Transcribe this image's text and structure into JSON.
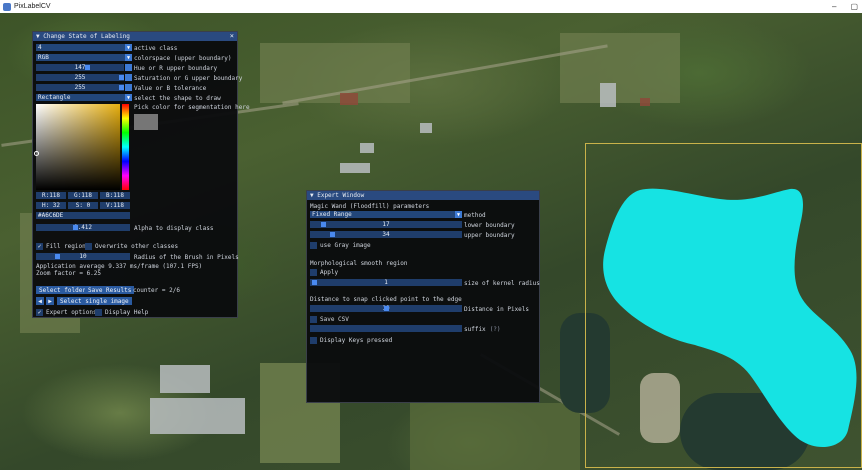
{
  "window": {
    "title": "PixLabelCV",
    "minimize": "–",
    "maximize": "▢"
  },
  "labeling": {
    "title": "▼ Change State of Labeling",
    "close": "×",
    "active_class_value": "4",
    "active_class_label": "active class",
    "colorspace_value": "RGB",
    "colorspace_label": "colorspace (upper boundary)",
    "hue_value": "147",
    "hue_label": "Hue or R upper boundary",
    "sat_value": "255",
    "sat_label": "Saturation or G upper boundary",
    "val_value": "255",
    "val_label": "Value or B tolerance",
    "shape_value": "Rectangle",
    "shape_label": "select the shape to draw",
    "pick_color_label": "Pick color for segmentation here",
    "rgb_r": "R:118",
    "rgb_g": "G:118",
    "rgb_b": "B:118",
    "hsv_h": "H: 32",
    "hsv_s": "S: 0",
    "hsv_v": "V:118",
    "hex": "#A6C6DE",
    "alpha_value": "0.412",
    "alpha_label": "Alpha to display class",
    "fill_region": "Fill region",
    "overwrite": "Overwrite other classes",
    "brush_value": "10",
    "brush_label": "Radius of the Brush in Pixels",
    "perf": "Application average 9.337 ms/frame (107.1 FPS)",
    "zoom": "Zoom factor = 6.25",
    "select_folder": "Select folder",
    "save_results": "Save Results",
    "counter": "counter = 2/6",
    "prev": "◀",
    "next": "▶",
    "select_image": "Select single image",
    "expert_options": "Expert options",
    "display_help": "Display Help",
    "hue_fraction": 0.58,
    "sat_fraction": 1.0,
    "val_fraction": 1.0,
    "alpha_fraction": 0.41,
    "brush_fraction": 0.2
  },
  "expert": {
    "title": "▼ Expert Window",
    "magic_wand_label": "Magic Wand (Floodfill) parameters",
    "method_value": "Fixed Range",
    "method_label": "method",
    "lower_value": "17",
    "lower_label": "lower boundary",
    "upper_value": "34",
    "upper_label": "upper boundary",
    "use_gray": "use Gray image",
    "morph_label": "Morphological smooth region",
    "apply": "Apply",
    "kernel_value": "1",
    "kernel_label": "size of kernel radius",
    "snap_label": "Distance to snap clicked point to the edge",
    "distance_value": "10",
    "distance_label": "Distance in Pixels",
    "save_csv": "Save CSV",
    "suffix_label": "suffix",
    "suffix_help": "(?)",
    "display_keys": "Display Keys pressed",
    "lower_fraction": 0.07,
    "upper_fraction": 0.13,
    "kernel_fraction": 0.01,
    "distance_fraction": 0.5
  },
  "colors": {
    "segmentation": "#16e3e3",
    "selection_rect": "#c9b24a",
    "imgui_header": "#2a4a80",
    "imgui_frame": "#1f3d6b",
    "imgui_button": "#2a5aa0"
  }
}
